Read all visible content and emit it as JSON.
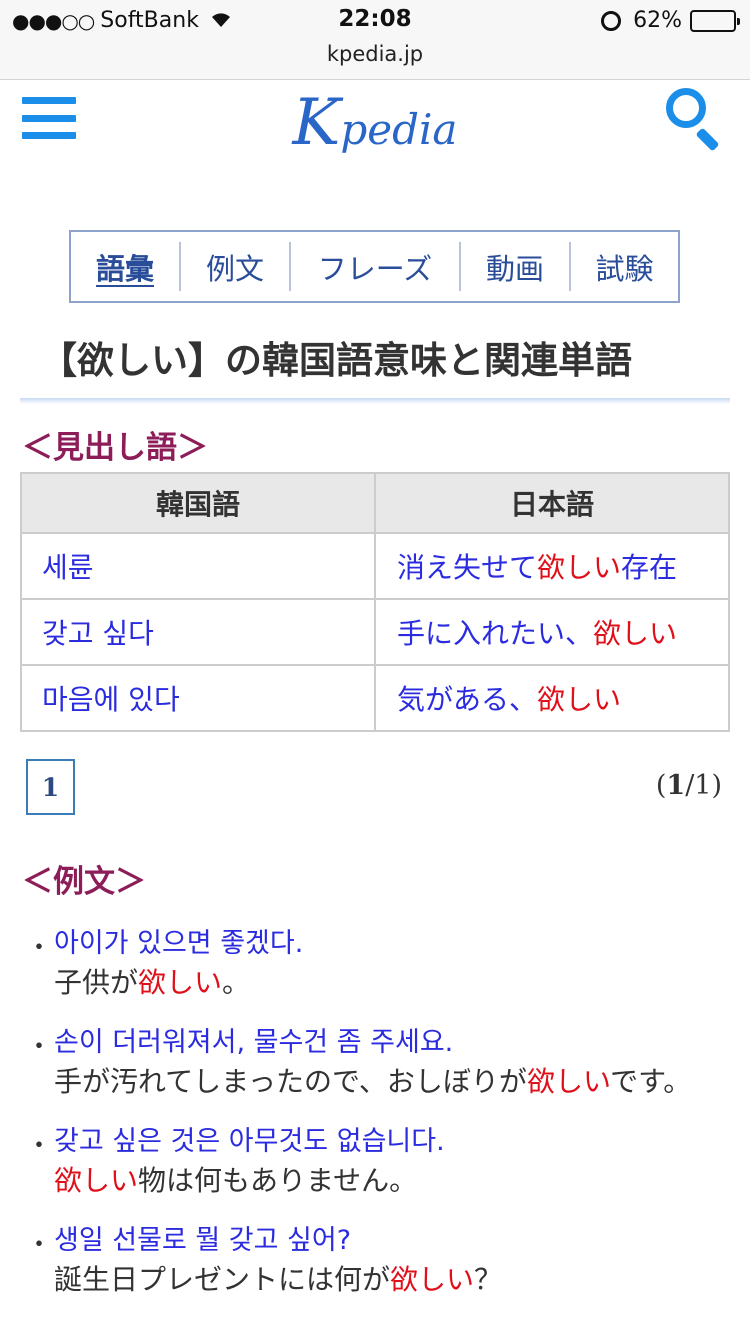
{
  "status_bar": {
    "carrier": "SoftBank",
    "signal_dots": "●●●○○",
    "time": "22:08",
    "battery": "62%",
    "battery_level": 0.62,
    "url": "kpedia.jp"
  },
  "header": {
    "logo_initial": "K",
    "logo_rest": "pedia"
  },
  "tabs": [
    {
      "label": "語彙",
      "active": true
    },
    {
      "label": "例文",
      "active": false
    },
    {
      "label": "フレーズ",
      "active": false
    },
    {
      "label": "動画",
      "active": false
    },
    {
      "label": "試験",
      "active": false
    }
  ],
  "page_title": "【欲しい】の韓国語意味と関連単語",
  "headword_section": {
    "heading": "＜見出し語＞",
    "columns": [
      "韓国語",
      "日本語"
    ],
    "rows": [
      {
        "korean": "세륜",
        "ja_pre": "消え失せて",
        "ja_hl": "欲しい",
        "ja_post": "存在"
      },
      {
        "korean": "갖고 싶다",
        "ja_pre": "手に入れたい、",
        "ja_hl": "欲しい",
        "ja_post": ""
      },
      {
        "korean": "마음에 있다",
        "ja_pre": "気がある、",
        "ja_hl": "欲しい",
        "ja_post": ""
      }
    ]
  },
  "pagination": {
    "current_page": "1",
    "open": "(",
    "current": "1",
    "total": "/1)"
  },
  "examples_section": {
    "heading": "＜例文＞",
    "bullet": "・",
    "items": [
      {
        "korean": "아이가 있으면 좋겠다.",
        "ja_pre": "子供が",
        "ja_hl": "欲しい",
        "ja_post": "。"
      },
      {
        "korean": "손이 더러워져서, 물수건 좀 주세요.",
        "ja_pre": "手が汚れてしまったので、おしぼりが",
        "ja_hl": "欲しい",
        "ja_post": "です。"
      },
      {
        "korean": "갖고 싶은 것은 아무것도 없습니다.",
        "ja_pre": "",
        "ja_hl": "欲しい",
        "ja_post": "物は何もありません。"
      },
      {
        "korean": "생일 선물로 뭘 갖고 싶어?",
        "ja_pre": "誕生日プレゼントには何が",
        "ja_hl": "欲しい",
        "ja_post": "？"
      }
    ]
  },
  "colors": {
    "accent_blue": "#1a8ee8",
    "link_blue": "#2b2be0",
    "highlight_red": "#e0101a",
    "heading_maroon": "#8c1d58"
  }
}
